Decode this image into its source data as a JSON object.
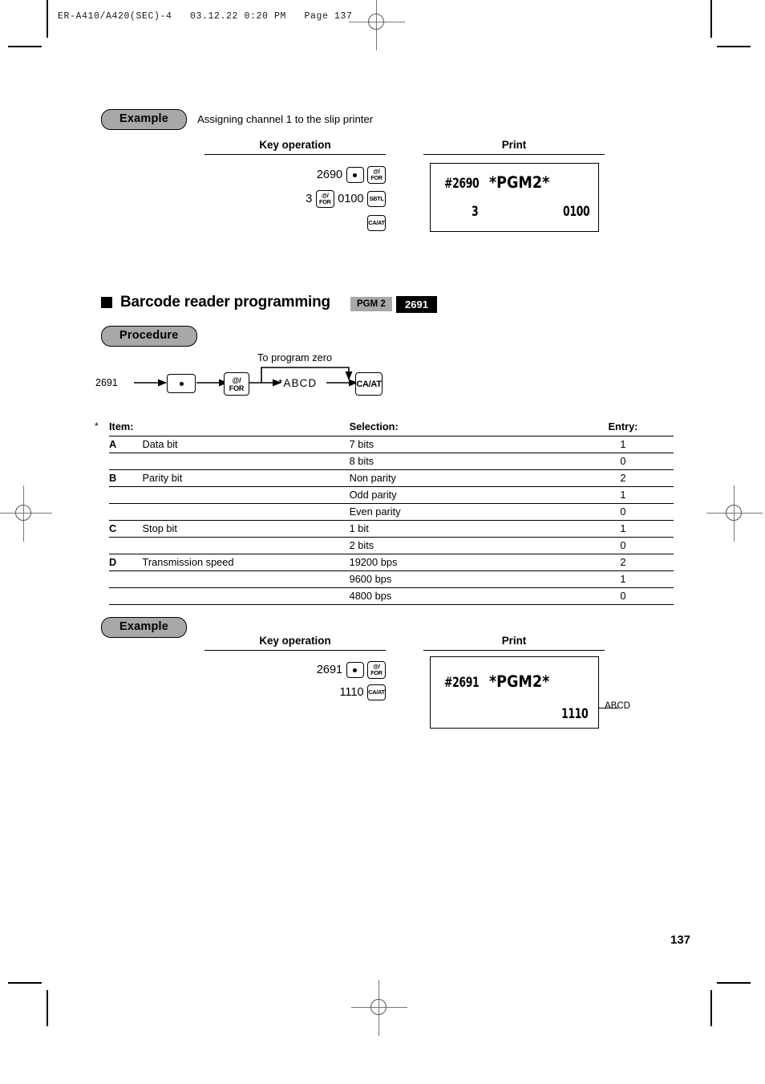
{
  "page": {
    "header_line": "ER-A410/A420(SEC)-4   03.12.22 0:20 PM   Page 137",
    "page_number": "137"
  },
  "example1": {
    "badge": "Example",
    "caption": "Assigning channel 1 to the slip printer",
    "key_operation_header": "Key operation",
    "print_header": "Print",
    "keys": {
      "row1_number": "2690",
      "row1_key1": "dot-key",
      "row1_key2": "@/FOR",
      "row2_number": "3",
      "row2_key1": "@/FOR",
      "row2_number2": "0100",
      "row2_key2": "SBTL",
      "row3_key": "CA/AT"
    },
    "print": {
      "line1_left": "#2690",
      "line1_right": "*PGM2*",
      "line2_left": "3",
      "line2_right": "0100"
    }
  },
  "section": {
    "title": "Barcode reader programming",
    "badge_pgm": "PGM 2",
    "badge_code": "2691",
    "procedure_badge": "Procedure",
    "colors": {
      "badge_gray": "#a8a8a8",
      "badge_black": "#000000"
    }
  },
  "procedure": {
    "start_number": "2691",
    "key_dot": "dot-key",
    "key_for": "@/FOR",
    "entry_label": "*ABCD",
    "key_caat": "CA/AT",
    "branch_label": "To program zero"
  },
  "table": {
    "footnote_mark": "*",
    "headers": {
      "item": "Item:",
      "selection": "Selection:",
      "entry": "Entry:"
    },
    "rows": [
      {
        "letter": "A",
        "item": "Data bit",
        "selection": "7 bits",
        "entry": "1"
      },
      {
        "letter": "",
        "item": "",
        "selection": "8 bits",
        "entry": "0"
      },
      {
        "letter": "B",
        "item": "Parity bit",
        "selection": "Non parity",
        "entry": "2"
      },
      {
        "letter": "",
        "item": "",
        "selection": "Odd parity",
        "entry": "1"
      },
      {
        "letter": "",
        "item": "",
        "selection": "Even parity",
        "entry": "0"
      },
      {
        "letter": "C",
        "item": "Stop bit",
        "selection": "1 bit",
        "entry": "1"
      },
      {
        "letter": "",
        "item": "",
        "selection": "2 bits",
        "entry": "0"
      },
      {
        "letter": "D",
        "item": "Transmission speed",
        "selection": "19200 bps",
        "entry": "2"
      },
      {
        "letter": "",
        "item": "",
        "selection": "9600 bps",
        "entry": "1"
      },
      {
        "letter": "",
        "item": "",
        "selection": "4800 bps",
        "entry": "0"
      }
    ]
  },
  "example2": {
    "badge": "Example",
    "key_operation_header": "Key operation",
    "print_header": "Print",
    "keys": {
      "row1_number": "2691",
      "row1_key1": "dot-key",
      "row1_key2": "@/FOR",
      "row2_number": "1110",
      "row2_key": "CA/AT"
    },
    "print": {
      "line1_left": "#2691",
      "line1_right": "*PGM2*",
      "line2_right": "1110"
    },
    "callout": "ABCD"
  }
}
